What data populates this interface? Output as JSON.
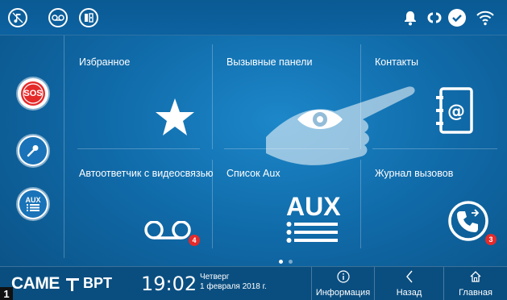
{
  "statusbar": {
    "left_icons": [
      "mute-ringtone-icon",
      "answering-machine-icon",
      "door-lock-icon"
    ],
    "right_icons": [
      "bell-icon",
      "connection-icon",
      "check-icon",
      "wifi-icon"
    ]
  },
  "sidebar": {
    "buttons": [
      {
        "name": "sos-button",
        "label": "SOS"
      },
      {
        "name": "key-button",
        "icon": "key-icon"
      },
      {
        "name": "aux-button",
        "label": "AUX"
      }
    ]
  },
  "tiles": [
    {
      "label": "Избранное",
      "icon": "star-icon"
    },
    {
      "label": "Вызывные панели",
      "icon": "eye-icon"
    },
    {
      "label": "Контакты",
      "icon": "address-book-icon"
    },
    {
      "label": "Автоответчик с видеосвязью",
      "icon": "answering-machine-icon",
      "badge": "4"
    },
    {
      "label": "Список Aux",
      "icon": "aux-list-icon",
      "icon_text": "AUX"
    },
    {
      "label": "Журнал вызовов",
      "icon": "call-log-icon",
      "badge": "3"
    }
  ],
  "pager": {
    "pages": 2,
    "current": 1
  },
  "bottombar": {
    "brand1": "CAME",
    "brand2": "BPT",
    "time": "19:02",
    "day": "Четверг",
    "date": "1 февраля 2018 г.",
    "nav": [
      {
        "label": "Информация",
        "icon": "info-icon"
      },
      {
        "label": "Назад",
        "icon": "back-icon"
      },
      {
        "label": "Главная",
        "icon": "home-icon"
      }
    ]
  },
  "corner_number": "1",
  "colors": {
    "accent_red": "#e52a2a",
    "background": "#106aa8"
  }
}
